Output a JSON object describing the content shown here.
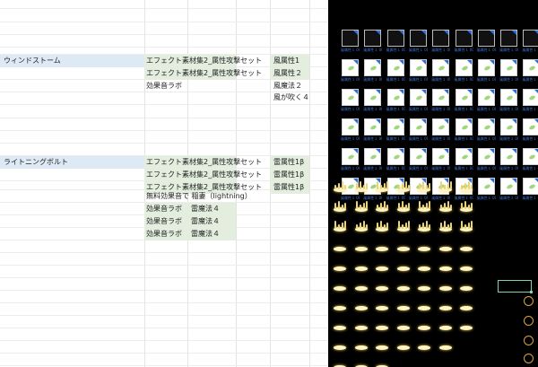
{
  "spreadsheet": {
    "wind": {
      "name": "ウィンドストーム",
      "materials": [
        {
          "source": "エフェクト素材集2_属性攻撃セット",
          "file": "風属性1"
        },
        {
          "source": "エフェクト素材集2_属性攻撃セット",
          "file": "風属性２"
        }
      ],
      "sound_source": "効果音ラボ",
      "sounds": [
        "風魔法２",
        "風が吹く４"
      ]
    },
    "lightning": {
      "name": "ライトニングボルト",
      "materials": [
        {
          "source": "エフェクト素材集2_属性攻撃セット",
          "file": "雷属性1β"
        },
        {
          "source": "エフェクト素材集2_属性攻撃セット",
          "file": "雷属性1β"
        },
        {
          "source": "エフェクト素材集2_属性攻撃セット",
          "file": "雷属性1β"
        }
      ],
      "free_sound": "無料効果音で 稲妻（lightning）",
      "sounds": [
        {
          "source": "効果音ラボ",
          "name": "雷魔法４"
        },
        {
          "source": "効果音ラボ",
          "name": "雷魔法４"
        },
        {
          "source": "効果音ラボ",
          "name": "雷魔法４"
        }
      ]
    }
  },
  "file_preview": {
    "thumbnail_rows": [
      [
        "風属性１\n0000.png",
        "風属性１\n0001.png",
        "風属性１\n0002.png",
        "風属性１\n0003.png",
        "風属性１\n0004.png",
        "風属性１\n0005.png",
        "風属性１\n0006.png",
        "風属性１\n0007.png",
        "風属性１\n0008.png"
      ],
      [
        "風属性１\n0010.png",
        "風属性１\n0011.png",
        "風属性１\n0012.png",
        "風属性１\n0013.png",
        "風属性１\n0014.png",
        "風属性１\n0015.png",
        "風属性１\n0016.png",
        "風属性１\n0017.png",
        "風属性１\n0018.png"
      ],
      [
        "風属性１\n0020.png",
        "風属性１\n0021.png",
        "風属性１\n0022.png",
        "風属性１\n0023.png",
        "風属性１\n0024.png",
        "風属性１\n0025.png",
        "風属性１\n0026.png",
        "風属性１\n0027.png",
        "風属性１\n0028.png"
      ],
      [
        "風属性１\n0030.png",
        "風属性１\n0031.png",
        "風属性１\n0032.png",
        "風属性１\n0033.png",
        "風属性１\n0034.png",
        "風属性１\n0035.png",
        "風属性１\n0036.png",
        "風属性１\n0037.png",
        "風属性１\n0038.png"
      ],
      [
        "風属性１\n0040.png",
        "風属性１\n0041.png",
        "風属性１\n0042.png",
        "風属性１\n0043.png",
        "風属性１\n0044.png",
        "風属性１\n0045.png",
        "風属性１\n0046.png",
        "風属性１\n0047.png",
        "風属性１\n0048.png"
      ],
      [
        "風属性１\n0050.png",
        "風属性１\n0051.png",
        "風属性１\n0052.png",
        "風属性１\n0053.png",
        "風属性１\n0054.png",
        "風属性１\n0055.png",
        "風属性１\n0056.png",
        "風属性１\n0057.png",
        "風属性１\n0058.png"
      ]
    ]
  }
}
